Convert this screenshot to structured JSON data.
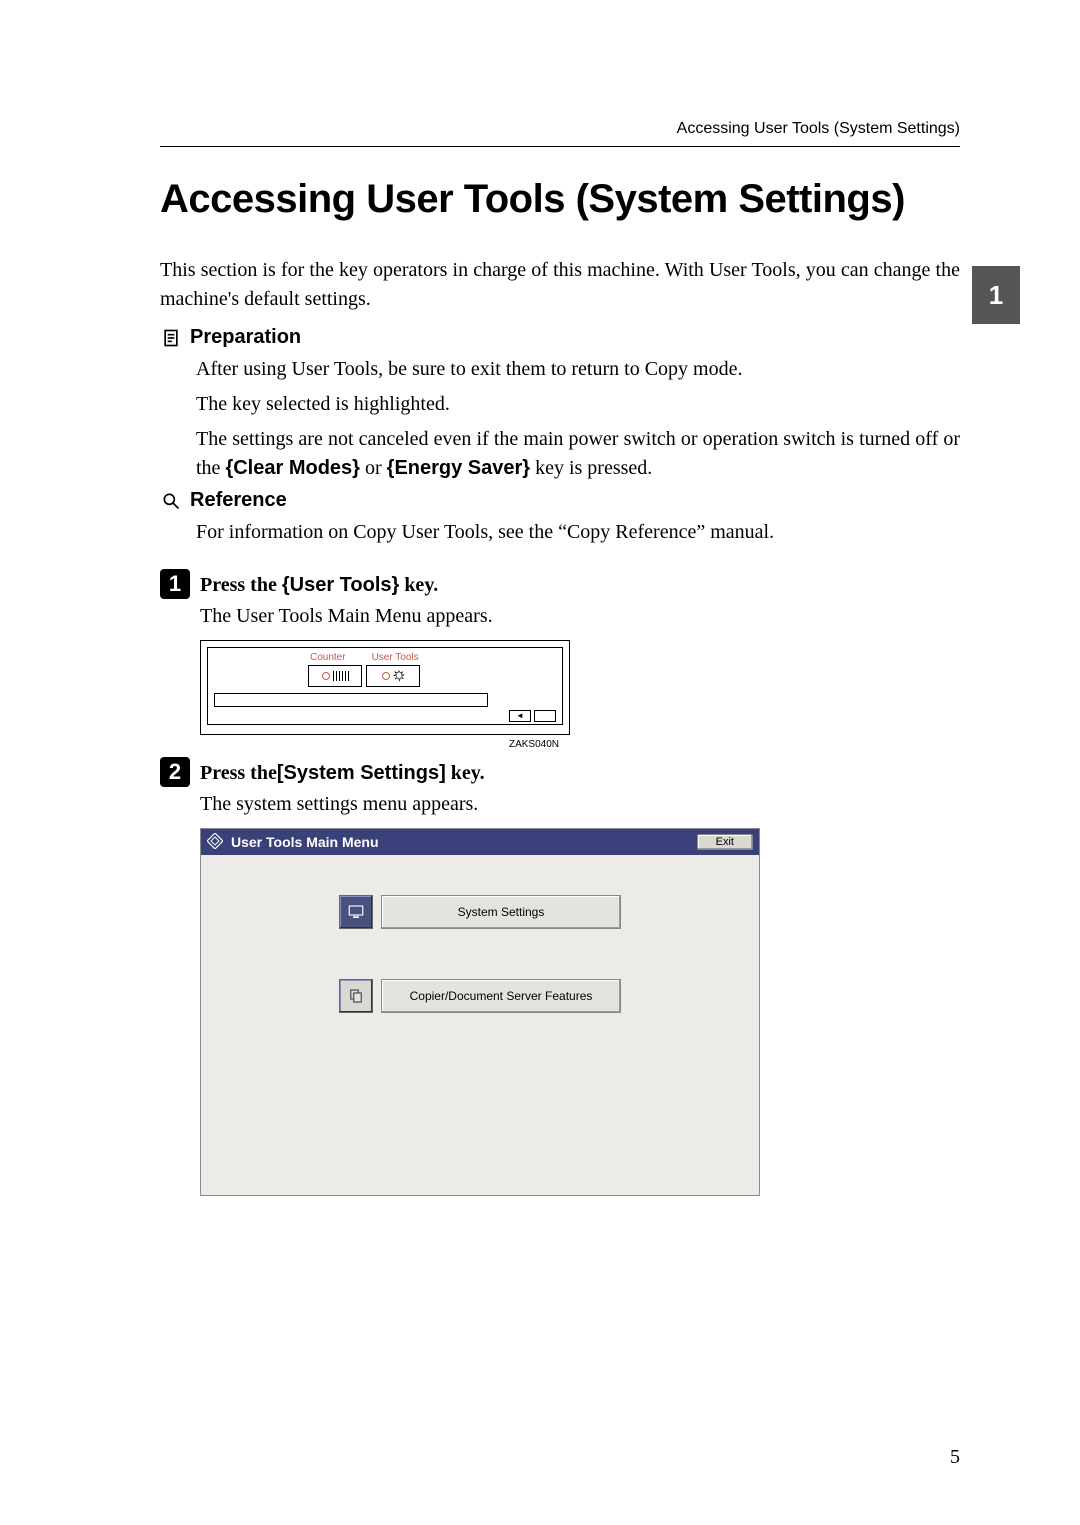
{
  "running_header": "Accessing User Tools (System Settings)",
  "title": "Accessing User Tools (System Settings)",
  "intro": "This section is for the key operators in charge of this machine. With User Tools, you can change the machine's default settings.",
  "preparation": {
    "heading": "Preparation",
    "lines": [
      "After using User Tools, be sure to exit them to return to Copy mode.",
      "The key selected is highlighted."
    ],
    "settings_prefix": "The settings are not canceled even if the main power switch or operation switch is turned off or the ",
    "key1": "Clear Modes",
    "between": " or ",
    "key2": "Energy Saver",
    "settings_suffix": " key is pressed."
  },
  "reference": {
    "heading": "Reference",
    "text": "For information on Copy User Tools, see the “Copy Reference” manual."
  },
  "steps": {
    "one": {
      "num": "1",
      "prefix": "Press the ",
      "key": "User Tools",
      "suffix": " key.",
      "sub": "The User Tools Main Menu appears.",
      "panel_label_counter": "Counter",
      "panel_label_usertools": "User Tools",
      "panel_code": "ZAKS040N"
    },
    "two": {
      "num": "2",
      "prefix": "Press the",
      "key": "[System Settings]",
      "suffix": "  key.",
      "sub": "The system settings menu appears."
    }
  },
  "screenshot": {
    "title": "User Tools Main Menu",
    "exit": "Exit",
    "btn1": "System Settings",
    "btn2": "Copier/Document Server Features"
  },
  "side_tab": "1",
  "page_number": "5"
}
